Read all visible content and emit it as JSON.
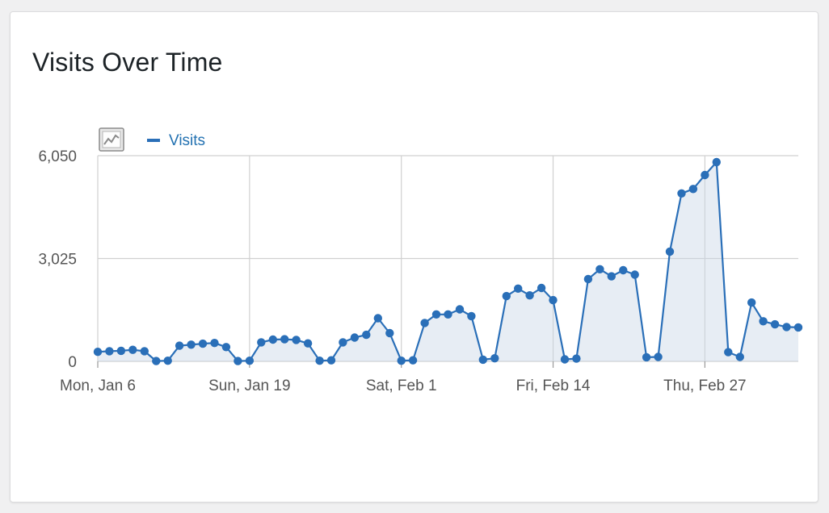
{
  "card": {
    "title": "Visits Over Time"
  },
  "legend": {
    "icon": "evolution-graph-icon",
    "series_name": "Visits"
  },
  "colors": {
    "series": "#2a6fb8",
    "area": "#c9d6e6",
    "grid": "#d0d0d0",
    "text": "#555555"
  },
  "chart_data": {
    "type": "line",
    "title": "Visits Over Time",
    "xlabel": "",
    "ylabel": "",
    "ylim": [
      0,
      6050
    ],
    "yticks": [
      0,
      3025,
      6050
    ],
    "ytick_labels": [
      "0",
      "3,025",
      "6,050"
    ],
    "xtick_labels": [
      "Mon, Jan 6",
      "Sun, Jan 19",
      "Sat, Feb 1",
      "Fri, Feb 14",
      "Thu, Feb 27"
    ],
    "xtick_dates": [
      "2020-01-06",
      "2020-01-19",
      "2020-02-01",
      "2020-02-14",
      "2020-02-27"
    ],
    "grid": true,
    "legend_position": "top-left",
    "x": [
      "2020-01-06",
      "2020-01-07",
      "2020-01-08",
      "2020-01-09",
      "2020-01-10",
      "2020-01-11",
      "2020-01-12",
      "2020-01-13",
      "2020-01-14",
      "2020-01-15",
      "2020-01-16",
      "2020-01-17",
      "2020-01-18",
      "2020-01-19",
      "2020-01-20",
      "2020-01-21",
      "2020-01-22",
      "2020-01-23",
      "2020-01-24",
      "2020-01-25",
      "2020-01-26",
      "2020-01-27",
      "2020-01-28",
      "2020-01-29",
      "2020-01-30",
      "2020-01-31",
      "2020-02-01",
      "2020-02-02",
      "2020-02-03",
      "2020-02-04",
      "2020-02-05",
      "2020-02-06",
      "2020-02-07",
      "2020-02-08",
      "2020-02-09",
      "2020-02-10",
      "2020-02-11",
      "2020-02-12",
      "2020-02-13",
      "2020-02-14",
      "2020-02-15",
      "2020-02-16",
      "2020-02-17",
      "2020-02-18",
      "2020-02-19",
      "2020-02-20",
      "2020-02-21",
      "2020-02-22",
      "2020-02-23",
      "2020-02-24",
      "2020-02-25",
      "2020-02-26",
      "2020-02-27",
      "2020-02-28",
      "2020-02-29",
      "2020-03-01",
      "2020-03-02",
      "2020-03-03",
      "2020-03-04",
      "2020-03-05",
      "2020-03-06"
    ],
    "series": [
      {
        "name": "Visits",
        "values": [
          280,
          300,
          310,
          340,
          300,
          10,
          20,
          460,
          490,
          520,
          540,
          420,
          10,
          20,
          560,
          640,
          650,
          630,
          530,
          20,
          30,
          560,
          700,
          780,
          1270,
          830,
          20,
          30,
          1130,
          1380,
          1380,
          1530,
          1330,
          50,
          90,
          1920,
          2140,
          1940,
          2160,
          1800,
          60,
          80,
          2420,
          2710,
          2500,
          2680,
          2550,
          120,
          130,
          3230,
          4940,
          5070,
          5480,
          5860,
          270,
          130,
          1730,
          1180,
          1090,
          1010,
          1000
        ]
      }
    ]
  }
}
